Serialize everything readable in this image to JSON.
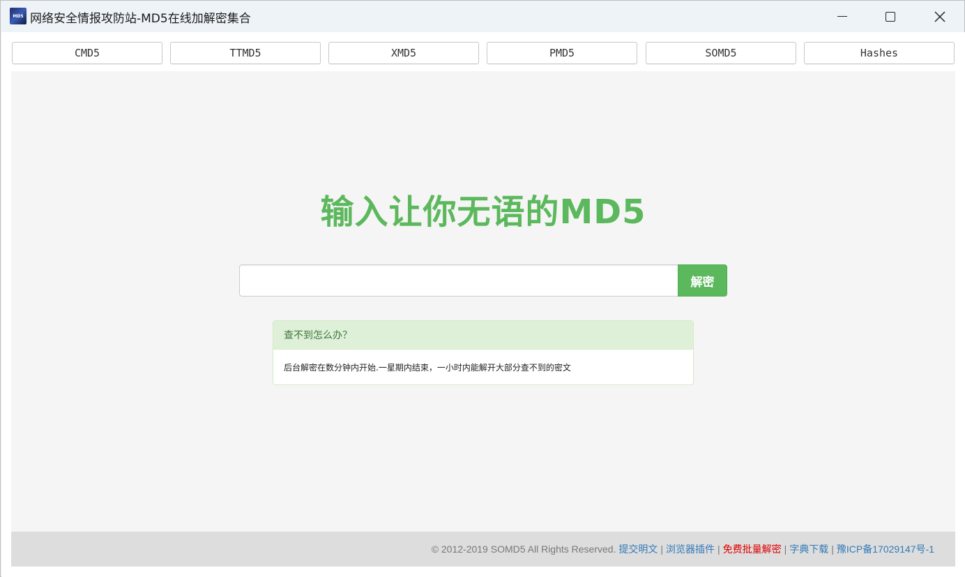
{
  "window": {
    "icon_text": "MD5",
    "title": "网络安全情报攻防站-MD5在线加解密集合"
  },
  "nav": {
    "items": [
      {
        "label": "CMD5"
      },
      {
        "label": "TTMD5"
      },
      {
        "label": "XMD5"
      },
      {
        "label": "PMD5"
      },
      {
        "label": "SOMD5"
      },
      {
        "label": "Hashes"
      }
    ]
  },
  "main": {
    "headline": "输入让你无语的MD5",
    "search": {
      "value": "",
      "placeholder": ""
    },
    "decrypt_label": "解密",
    "panel": {
      "title": "查不到怎么办？",
      "body": "后台解密在数分钟内开始.一星期内结束，一小时内能解开大部分查不到的密文"
    }
  },
  "footer": {
    "copyright": "© 2012-2019 SOMD5 All Rights Reserved.",
    "links": {
      "submit_plaintext": "提交明文",
      "browser_plugin": "浏览器插件",
      "free_batch": "免费批量解密",
      "dictionary": "字典下载",
      "icp": "豫ICP备17029147号-1"
    },
    "separator": "|",
    "colors": {
      "link": "#337ab7",
      "highlight": "#e00000"
    }
  },
  "colors": {
    "accent": "#5cb85c"
  }
}
